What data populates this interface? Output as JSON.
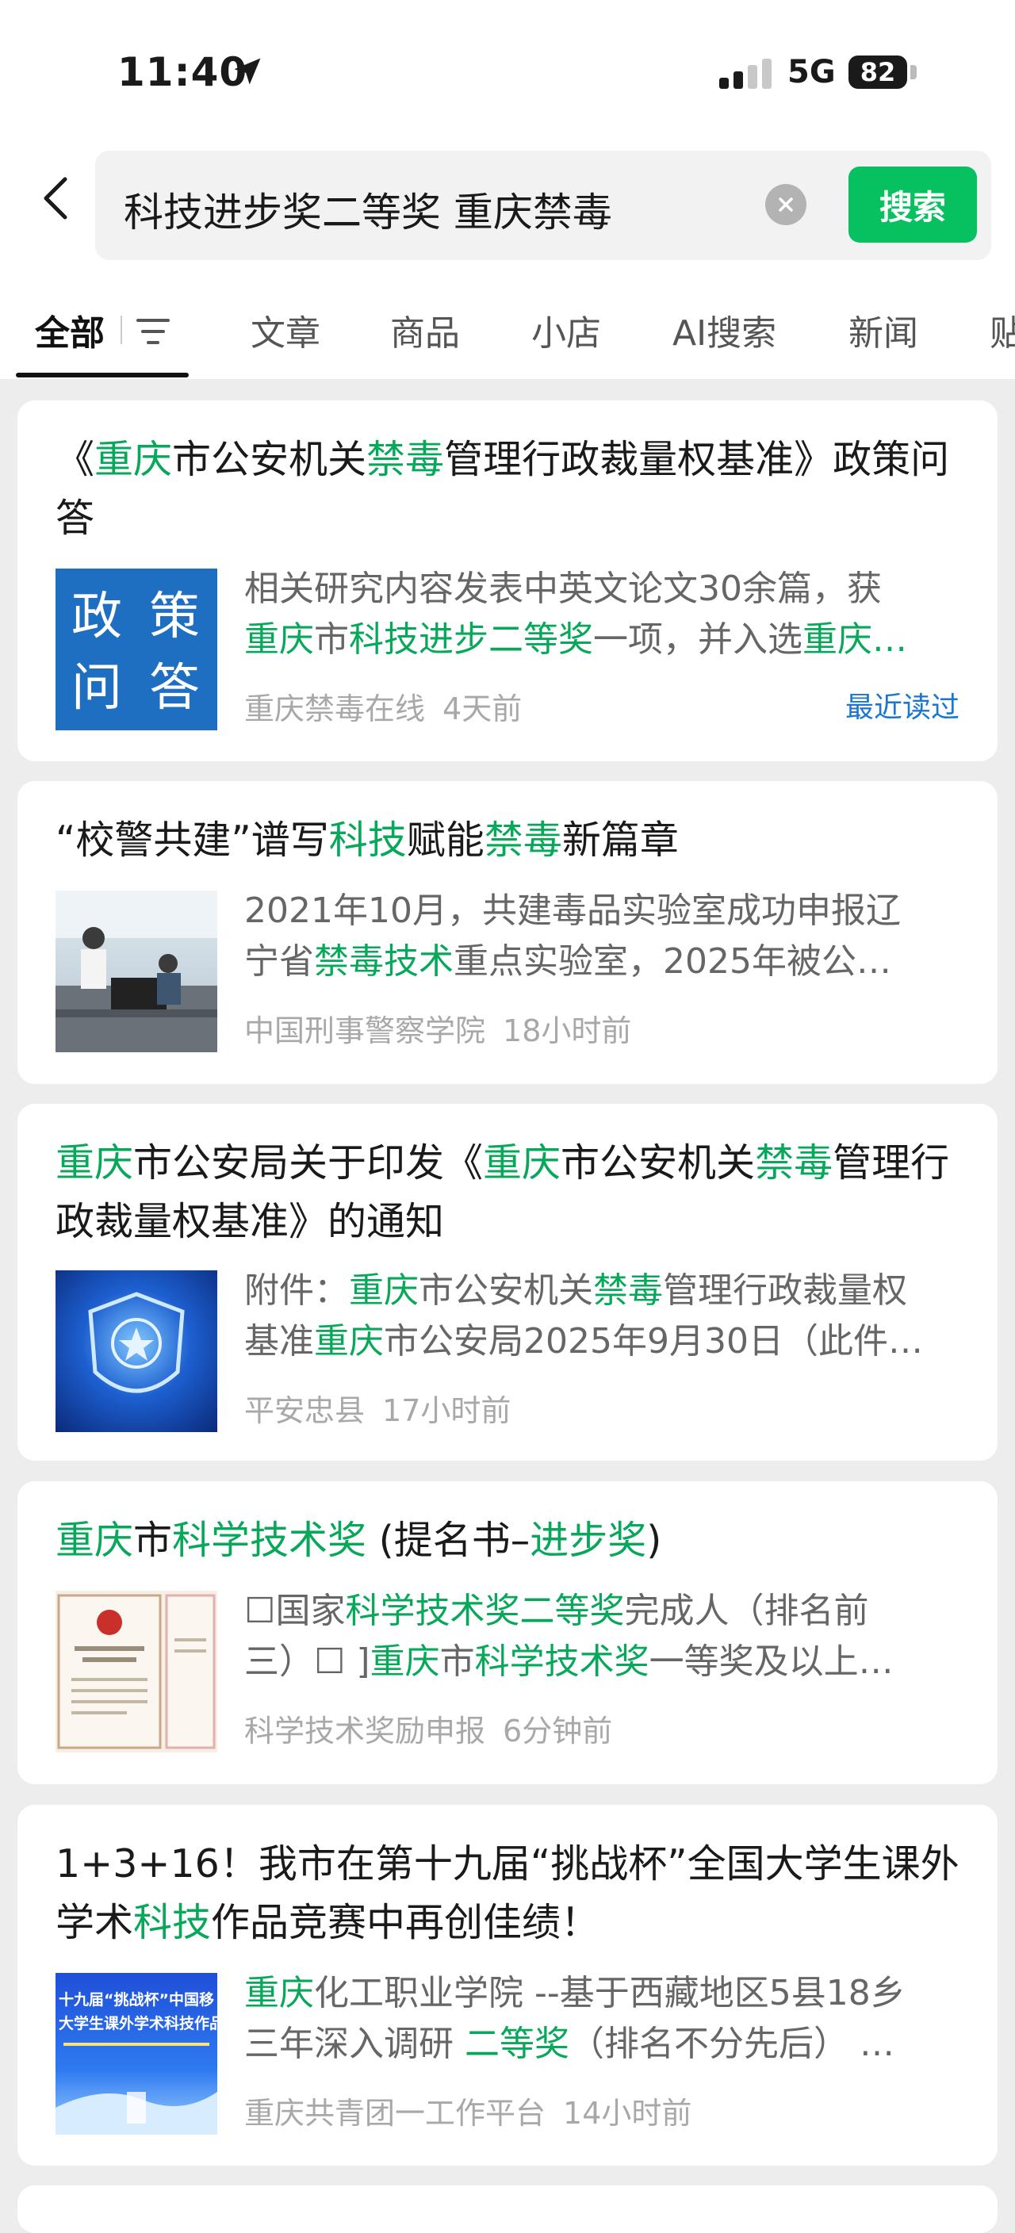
{
  "status_bar": {
    "time": "11:40",
    "network": "5G",
    "battery": "82"
  },
  "search": {
    "query": "科技进步奖二等奖 重庆禁毒",
    "button_label": "搜索"
  },
  "tabs": [
    "全部",
    "文章",
    "商品",
    "小店",
    "AI搜索",
    "新闻",
    "贴"
  ],
  "results": [
    {
      "title": [
        [
          "《",
          0
        ],
        [
          "重庆",
          1
        ],
        [
          "市公安机关",
          0
        ],
        [
          "禁毒",
          1
        ],
        [
          "管理行政裁量权基准》政策问答",
          0
        ]
      ],
      "thumb_text": [
        "政",
        "策",
        "问",
        "答"
      ],
      "snippet_lines": [
        [
          [
            "相关研究内容发表中英文论文30余篇，获",
            0
          ]
        ],
        [
          [
            "重庆",
            1
          ],
          [
            "市",
            0
          ],
          [
            "科技进步二等奖",
            1
          ],
          [
            "一项，并入选",
            0
          ],
          [
            "重庆…",
            1
          ]
        ]
      ],
      "source": "重庆禁毒在线",
      "time": "4天前",
      "tag": "最近读过"
    },
    {
      "title": [
        [
          "“校警共建”谱写",
          0
        ],
        [
          "科技",
          1
        ],
        [
          "赋能",
          0
        ],
        [
          "禁毒",
          1
        ],
        [
          "新篇章",
          0
        ]
      ],
      "snippet_lines": [
        [
          [
            "2021年10月，共建毒品实验室成功申报辽",
            0
          ]
        ],
        [
          [
            "宁省",
            0
          ],
          [
            "禁毒技术",
            1
          ],
          [
            "重点实验室，2025年被公…",
            0
          ]
        ]
      ],
      "source": "中国刑事警察学院",
      "time": "18小时前"
    },
    {
      "title": [
        [
          "重庆",
          1
        ],
        [
          "市公安局关于印发《",
          0
        ],
        [
          "重庆",
          1
        ],
        [
          "市公安机关",
          0
        ],
        [
          "禁毒",
          1
        ],
        [
          "管理行政裁量权基准》的通知",
          0
        ]
      ],
      "snippet_lines": [
        [
          [
            "附件：",
            0
          ],
          [
            "重庆",
            1
          ],
          [
            "市公安机关",
            0
          ],
          [
            "禁毒",
            1
          ],
          [
            "管理行政裁量权",
            0
          ]
        ],
        [
          [
            "基准",
            0
          ],
          [
            "重庆",
            1
          ],
          [
            "市公安局2025年9月30日（此件…",
            0
          ]
        ]
      ],
      "source": "平安忠县",
      "time": "17小时前"
    },
    {
      "title": [
        [
          "重庆",
          1
        ],
        [
          "市",
          0
        ],
        [
          "科学技术奖",
          1
        ],
        [
          " (提名书–",
          0
        ],
        [
          "进步奖",
          1
        ],
        [
          ")",
          0
        ]
      ],
      "snippet_lines": [
        [
          [
            "☐国家",
            0
          ],
          [
            "科学技术奖二等奖",
            1
          ],
          [
            "完成人（排名前",
            0
          ]
        ],
        [
          [
            "三）☐ ]",
            0
          ],
          [
            "重庆",
            1
          ],
          [
            "市",
            0
          ],
          [
            "科学技术奖",
            1
          ],
          [
            "一等奖及以上…",
            0
          ]
        ]
      ],
      "source": "科学技术奖励申报",
      "time": "6分钟前"
    },
    {
      "title": [
        [
          "1+3+16！我市在第十九届“挑战杯”全国大学生课外学术",
          0
        ],
        [
          "科技",
          1
        ],
        [
          "作品竞赛中再创佳绩！",
          0
        ]
      ],
      "thumb_text": [
        "十九届“挑战杯”中国移",
        "大学生课外学术科技作品"
      ],
      "snippet_lines": [
        [
          [
            "重庆",
            1
          ],
          [
            "化工职业学院 --基于西藏地区5县18乡",
            0
          ]
        ],
        [
          [
            "三年深入调研 ",
            0
          ],
          [
            "二等奖",
            1
          ],
          [
            "（排名不分先后） …",
            0
          ]
        ]
      ],
      "source": "重庆共青团一工作平台",
      "time": "14小时前"
    }
  ],
  "colors": {
    "accent": "#07c160",
    "highlight": "#07a85a",
    "recent": "#1976d2"
  }
}
